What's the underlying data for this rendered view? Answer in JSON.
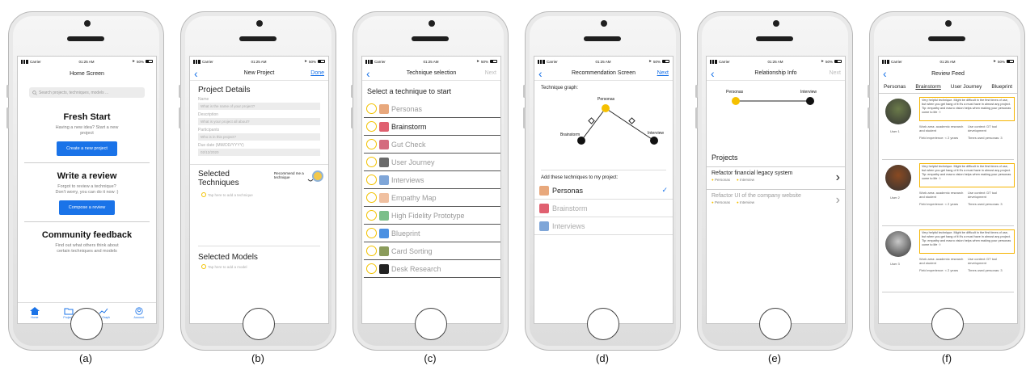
{
  "status": {
    "carrier": "Carrier",
    "time": "01:25 AM",
    "battery": "50%"
  },
  "captions": [
    "(a)",
    "(b)",
    "(c)",
    "(d)",
    "(e)",
    "(f)"
  ],
  "home": {
    "title": "Home Screen",
    "search_placeholder": "Search projects, techniques, models ...",
    "fresh_title": "Fresh Start",
    "fresh_text": "Having a new idea? Start a new project",
    "fresh_button": "Create a new project",
    "review_title": "Write a review",
    "review_text": "Forgot to review a technique? Don't worry, you can do it now :)",
    "review_button": "Compose a review",
    "community_title": "Community feedback",
    "community_text": "Find out what others think about certain techniques and models",
    "tabs": [
      "Home",
      "Projects",
      "DT Graph",
      "Account"
    ]
  },
  "new_project": {
    "title": "New Project",
    "done": "Done",
    "details": "Project Details",
    "fields": [
      {
        "label": "Name",
        "placeholder": "What is the name of your project?"
      },
      {
        "label": "Description",
        "placeholder": "What is your project all about?"
      },
      {
        "label": "Participants",
        "placeholder": "Who is in this project?"
      },
      {
        "label": "Due date (MM/DD/YYYY)",
        "placeholder": "02/12/2020"
      }
    ],
    "selected_techniques": "Selected Techniques",
    "recommend": "Recommend me a technique",
    "tap_technique": "Tap here to add a technique",
    "selected_models": "Selected Models",
    "tap_model": "Tap here to add a model"
  },
  "technique": {
    "title": "Technique selection",
    "next": "Next",
    "heading": "Select a technique to start",
    "items": [
      "Personas",
      "Brainstorm",
      "Gut Check",
      "User Journey",
      "Interviews",
      "Empathy Map",
      "High Fidelity Prototype",
      "Blueprint",
      "Card Sorting",
      "Desk Research"
    ],
    "colors": [
      "#e8a87c",
      "#e06070",
      "#d46a7e",
      "#6a6a6a",
      "#7fa6d8",
      "#f0c0a0",
      "#7bbf8a",
      "#4a90e2",
      "#8a9b5a",
      "#222222"
    ]
  },
  "recommendation": {
    "title": "Recommendation Screen",
    "next": "Next",
    "graph_label": "Technique graph:",
    "nodes": [
      "Personas",
      "Brainstorm",
      "Interview"
    ],
    "add_label": "Add these techniques to my project:",
    "items": [
      "Personas",
      "Brainstorm",
      "Interviews"
    ]
  },
  "relationship": {
    "title": "Relationship Info",
    "next": "Next",
    "node_a": "Personas",
    "node_b": "Interview",
    "projects_label": "Projects",
    "projects": [
      {
        "name": "Refactor financial legacy system",
        "tags": [
          "Personas",
          "Interview"
        ]
      },
      {
        "name": "Refactor UI of the company website",
        "tags": [
          "Personas",
          "Interview"
        ]
      }
    ]
  },
  "review_feed": {
    "title": "Review Feed",
    "tabs": [
      "Personas",
      "Brainstorm",
      "User Journey",
      "Blueprint"
    ],
    "review_text": "Very helpful technique. Might be difficult in the first times of use, but when you get hang of it it's a must have in almost any project. Tip: empathy and macro vision helps when making your personas come to life ☺",
    "reviews": [
      {
        "user": "User 1",
        "work_area": "Work area: academic research and student",
        "use_context": "Use context: DT tool development",
        "experience": "Field experience: < 2 years",
        "times": "Times used personas: 3"
      },
      {
        "user": "User 2",
        "work_area": "Work area: academic research and student",
        "use_context": "Use context: DT tool development",
        "experience": "Field experience: < 2 years",
        "times": "Times used personas: 3"
      },
      {
        "user": "User 3",
        "work_area": "Work area: academic research and student",
        "use_context": "Use context: DT tool development",
        "experience": "Field experience: < 2 years",
        "times": "Times used personas: 3"
      }
    ],
    "avatar_colors": [
      "#6b7b4a",
      "#8a4a22",
      "#c9c9c9"
    ]
  }
}
